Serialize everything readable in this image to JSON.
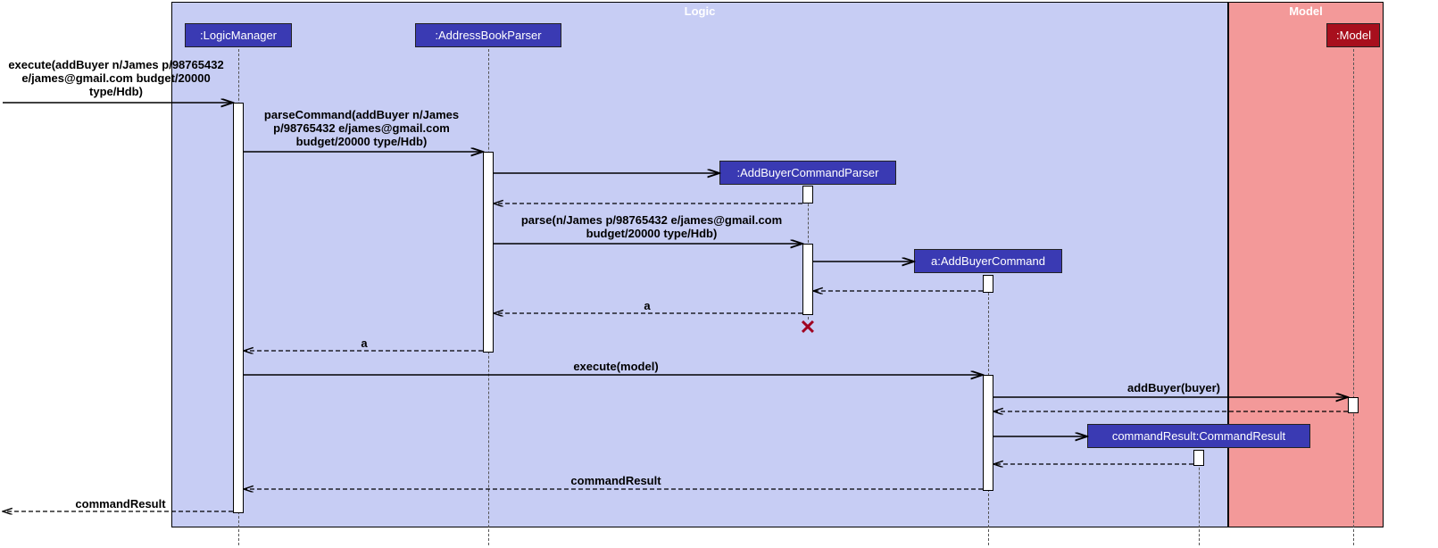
{
  "regions": {
    "logic": {
      "title": "Logic"
    },
    "model": {
      "title": "Model"
    }
  },
  "participants": {
    "logicManager": ":LogicManager",
    "addressBookParser": ":AddressBookParser",
    "addBuyerCommandParser": ":AddBuyerCommandParser",
    "addBuyerCommand": "a:AddBuyerCommand",
    "commandResult": "commandResult:CommandResult",
    "model": ":Model"
  },
  "messages": {
    "m1": "execute(addBuyer n/James p/98765432 e/james@gmail.com budget/20000 type/Hdb)",
    "m2": "parseCommand(addBuyer n/James p/98765432 e/james@gmail.com budget/20000 type/Hdb)",
    "m3": "parse(n/James p/98765432 e/james@gmail.com budget/20000 type/Hdb)",
    "m4": "a",
    "m5": "a",
    "m6": "execute(model)",
    "m7": "addBuyer(buyer)",
    "m8": "commandResult",
    "m9": "commandResult"
  },
  "chart_data": {
    "type": "sequence_diagram",
    "regions": [
      {
        "name": "Logic",
        "participants": [
          ":LogicManager",
          ":AddressBookParser",
          ":AddBuyerCommandParser",
          "a:AddBuyerCommand",
          "commandResult:CommandResult"
        ]
      },
      {
        "name": "Model",
        "participants": [
          ":Model"
        ]
      }
    ],
    "messages": [
      {
        "from": "caller",
        "to": ":LogicManager",
        "label": "execute(addBuyer n/James p/98765432 e/james@gmail.com budget/20000 type/Hdb)",
        "type": "sync"
      },
      {
        "from": ":LogicManager",
        "to": ":AddressBookParser",
        "label": "parseCommand(addBuyer n/James p/98765432 e/james@gmail.com budget/20000 type/Hdb)",
        "type": "sync"
      },
      {
        "from": ":AddressBookParser",
        "to": ":AddBuyerCommandParser",
        "label": "",
        "type": "create"
      },
      {
        "from": ":AddBuyerCommandParser",
        "to": ":AddressBookParser",
        "label": "",
        "type": "return"
      },
      {
        "from": ":AddressBookParser",
        "to": ":AddBuyerCommandParser",
        "label": "parse(n/James p/98765432 e/james@gmail.com budget/20000 type/Hdb)",
        "type": "sync"
      },
      {
        "from": ":AddBuyerCommandParser",
        "to": "a:AddBuyerCommand",
        "label": "",
        "type": "create"
      },
      {
        "from": "a:AddBuyerCommand",
        "to": ":AddBuyerCommandParser",
        "label": "",
        "type": "return"
      },
      {
        "from": ":AddBuyerCommandParser",
        "to": ":AddressBookParser",
        "label": "a",
        "type": "return"
      },
      {
        "from": ":AddBuyerCommandParser",
        "to": null,
        "label": "",
        "type": "destroy"
      },
      {
        "from": ":AddressBookParser",
        "to": ":LogicManager",
        "label": "a",
        "type": "return"
      },
      {
        "from": ":LogicManager",
        "to": "a:AddBuyerCommand",
        "label": "execute(model)",
        "type": "sync"
      },
      {
        "from": "a:AddBuyerCommand",
        "to": ":Model",
        "label": "addBuyer(buyer)",
        "type": "sync"
      },
      {
        "from": ":Model",
        "to": "a:AddBuyerCommand",
        "label": "",
        "type": "return"
      },
      {
        "from": "a:AddBuyerCommand",
        "to": "commandResult:CommandResult",
        "label": "",
        "type": "create"
      },
      {
        "from": "commandResult:CommandResult",
        "to": "a:AddBuyerCommand",
        "label": "",
        "type": "return"
      },
      {
        "from": "a:AddBuyerCommand",
        "to": ":LogicManager",
        "label": "commandResult",
        "type": "return"
      },
      {
        "from": ":LogicManager",
        "to": "caller",
        "label": "commandResult",
        "type": "return"
      }
    ]
  }
}
